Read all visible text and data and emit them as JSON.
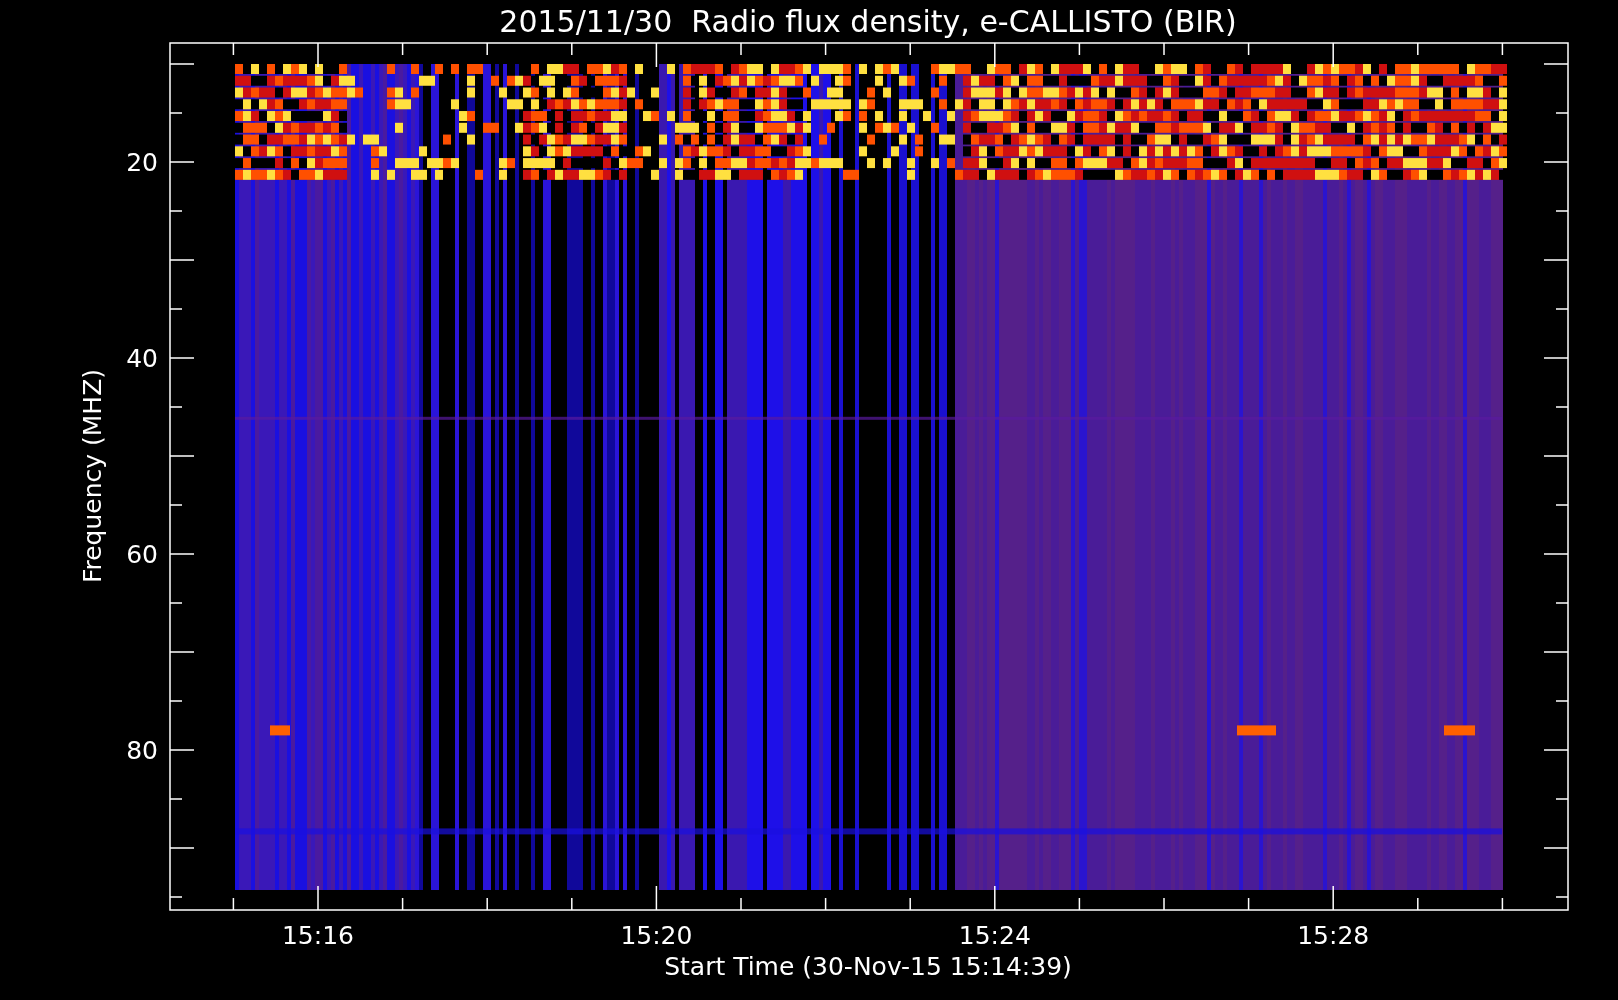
{
  "title": "2015/11/30  Radio flux density, e-CALLISTO (BIR)",
  "x_axis": {
    "label": "Start Time (30-Nov-15 15:14:39)",
    "ticks": [
      "15:16",
      "15:20",
      "15:24",
      "15:28"
    ]
  },
  "y_axis": {
    "label": "Frequency (MHZ)",
    "ticks": [
      "20",
      "40",
      "60",
      "80"
    ]
  }
}
